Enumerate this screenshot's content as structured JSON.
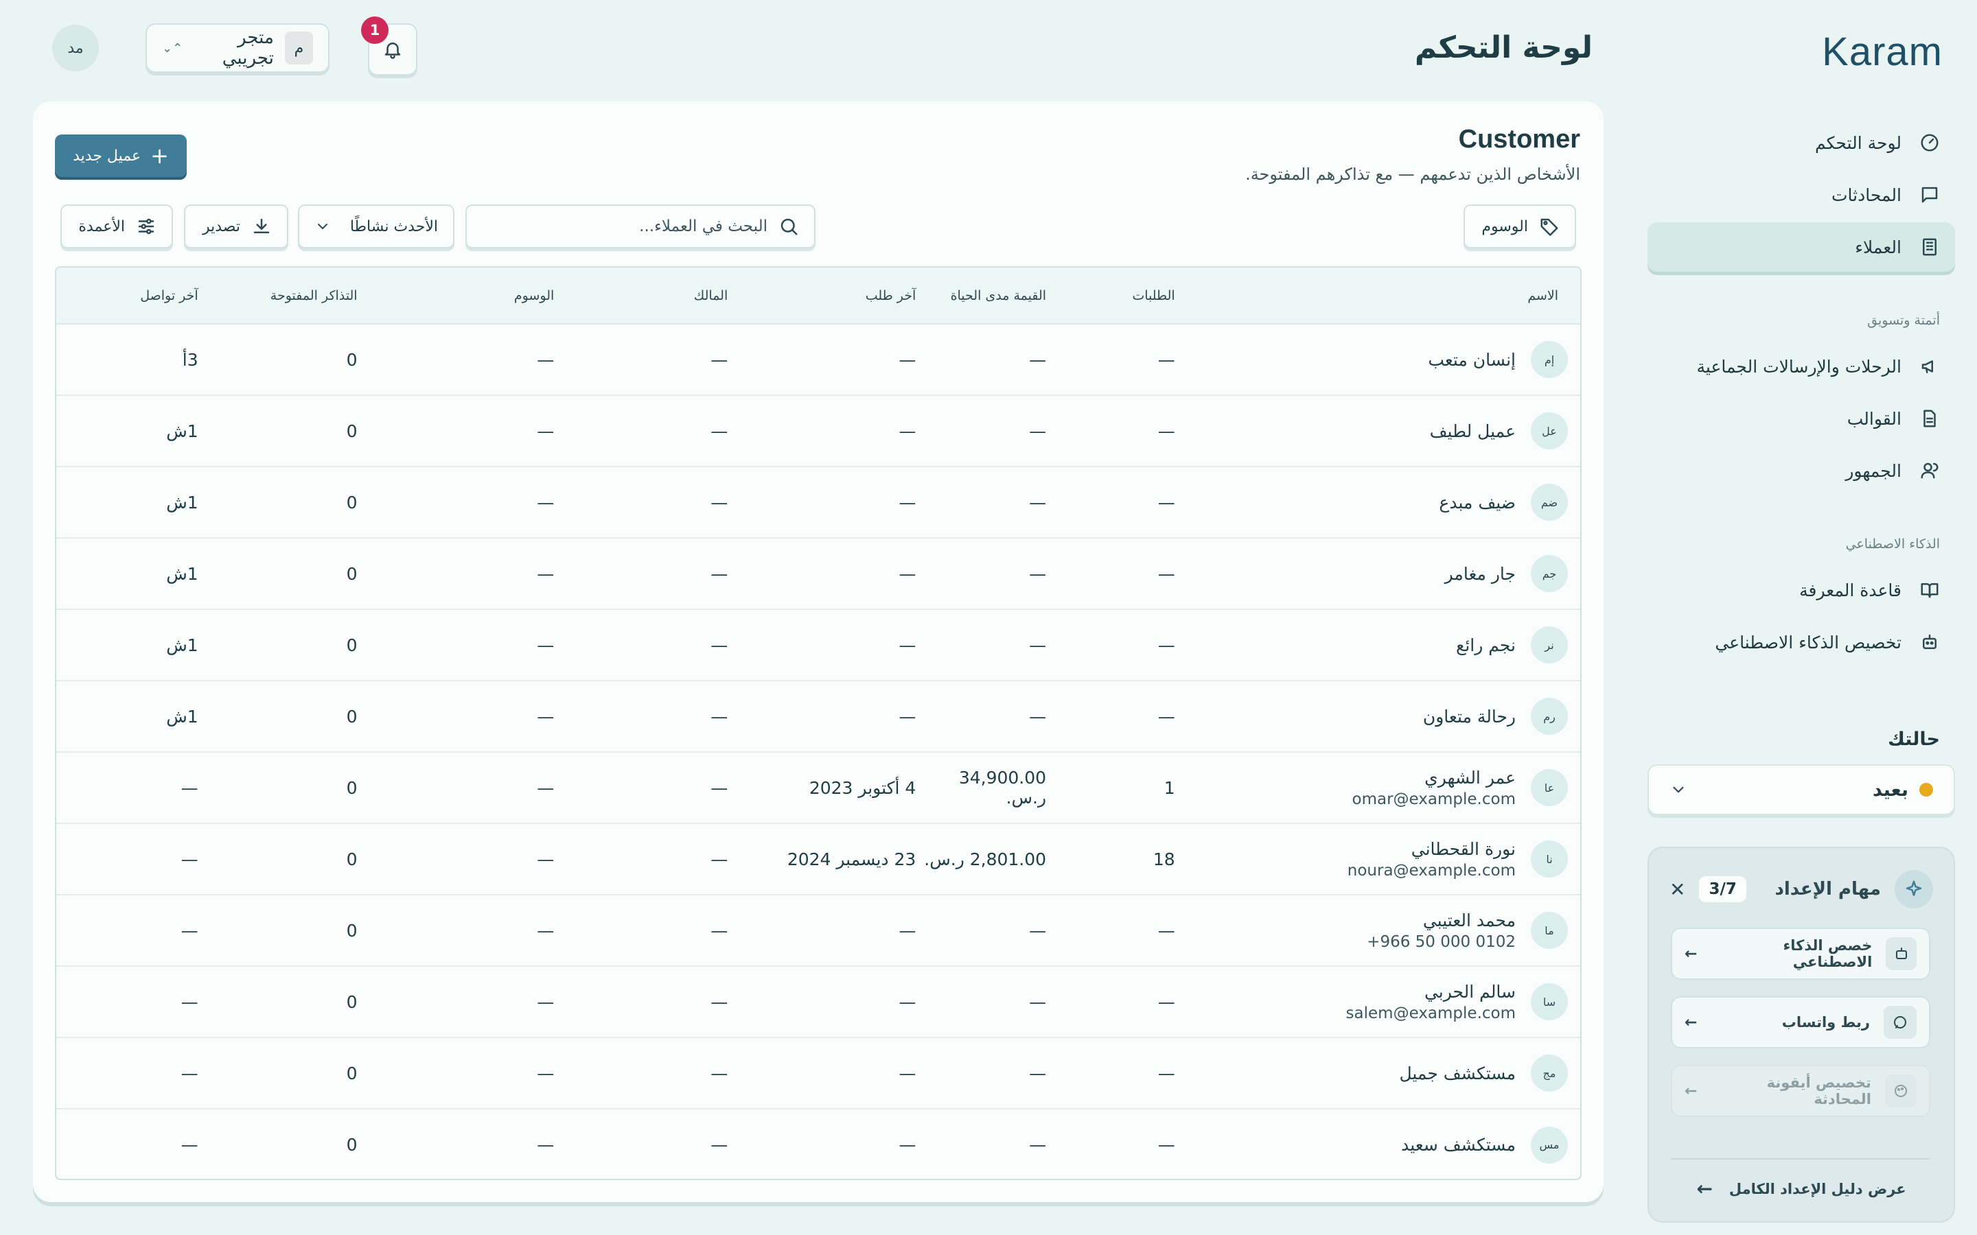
{
  "sidebar": {
    "logo": "Karam",
    "nav": [
      {
        "label": "لوحة التحكم",
        "icon": "gauge-icon",
        "active": false
      },
      {
        "label": "المحادثات",
        "icon": "chat-icon",
        "active": false
      },
      {
        "label": "العملاء",
        "icon": "building-icon",
        "active": true
      }
    ],
    "section_marketing": "أتمتة وتسويق",
    "marketing": [
      {
        "label": "الرحلات والإرسالات الجماعية",
        "icon": "megaphone-icon"
      },
      {
        "label": "القوالب",
        "icon": "document-icon"
      },
      {
        "label": "الجمهور",
        "icon": "users-icon"
      }
    ],
    "section_ai": "الذكاء الاصطناعي",
    "ai": [
      {
        "label": "قاعدة المعرفة",
        "icon": "book-icon"
      },
      {
        "label": "تخصيص الذكاء الاصطناعي",
        "icon": "bot-icon"
      }
    ],
    "status_title": "حالتك",
    "status_value": "بعيد",
    "status_color": "#e8a91c",
    "setup": {
      "title": "مهام الإعداد",
      "count": "3/7",
      "tasks": [
        {
          "label": "خصص الذكاء الاصطناعي",
          "icon": "bot-icon"
        },
        {
          "label": "ربط واتساب",
          "icon": "chat-icon"
        },
        {
          "label": "تخصيص أيقونة المحادثة",
          "icon": "palette-icon"
        }
      ],
      "guide": "عرض دليل الإعداد الكامل"
    }
  },
  "topbar": {
    "title": "لوحة التحكم",
    "notifications": "1",
    "store_name": "متجر تجريبي",
    "store_initial": "م",
    "user_initials": "مد"
  },
  "main": {
    "title": "Customer",
    "subtitle": "الأشخاص الذين تدعمهم — مع تذاكرهم المفتوحة.",
    "new_button": "عميل جديد",
    "tags_button": "الوسوم",
    "search_placeholder": "البحث في العملاء...",
    "sort_label": "الأحدث نشاطًا",
    "export_label": "تصدير",
    "columns_label": "الأعمدة",
    "accent_color": "#3f7d98"
  },
  "table": {
    "headers": [
      "الاسم",
      "الطلبات",
      "القيمة مدى الحياة",
      "آخر طلب",
      "المالك",
      "الوسوم",
      "التذاكر المفتوحة",
      "آخر تواصل"
    ],
    "rows": [
      {
        "initials": "إم",
        "name": "إنسان متعب",
        "sub": "",
        "orders": "—",
        "ltv": "—",
        "last_order": "—",
        "owner": "—",
        "tags": "—",
        "tickets": "0",
        "contact": "3أ"
      },
      {
        "initials": "عل",
        "name": "عميل لطيف",
        "sub": "",
        "orders": "—",
        "ltv": "—",
        "last_order": "—",
        "owner": "—",
        "tags": "—",
        "tickets": "0",
        "contact": "1ش"
      },
      {
        "initials": "ضم",
        "name": "ضيف مبدع",
        "sub": "",
        "orders": "—",
        "ltv": "—",
        "last_order": "—",
        "owner": "—",
        "tags": "—",
        "tickets": "0",
        "contact": "1ش"
      },
      {
        "initials": "جم",
        "name": "جار مغامر",
        "sub": "",
        "orders": "—",
        "ltv": "—",
        "last_order": "—",
        "owner": "—",
        "tags": "—",
        "tickets": "0",
        "contact": "1ش"
      },
      {
        "initials": "نر",
        "name": "نجم رائع",
        "sub": "",
        "orders": "—",
        "ltv": "—",
        "last_order": "—",
        "owner": "—",
        "tags": "—",
        "tickets": "0",
        "contact": "1ش"
      },
      {
        "initials": "رم",
        "name": "رحالة متعاون",
        "sub": "",
        "orders": "—",
        "ltv": "—",
        "last_order": "—",
        "owner": "—",
        "tags": "—",
        "tickets": "0",
        "contact": "1ش"
      },
      {
        "initials": "عا",
        "name": "عمر الشهري",
        "sub": "omar@example.com",
        "orders": "1",
        "ltv": "34,900.00 ر.س.",
        "last_order": "4 أكتوبر 2023",
        "owner": "—",
        "tags": "—",
        "tickets": "0",
        "contact": "—"
      },
      {
        "initials": "نا",
        "name": "نورة القحطاني",
        "sub": "noura@example.com",
        "orders": "18",
        "ltv": "2,801.00 ر.س.",
        "last_order": "23 ديسمبر 2024",
        "owner": "—",
        "tags": "—",
        "tickets": "0",
        "contact": "—"
      },
      {
        "initials": "ما",
        "name": "محمد العتيبي",
        "sub": "+966 50 000 0102",
        "orders": "—",
        "ltv": "—",
        "last_order": "—",
        "owner": "—",
        "tags": "—",
        "tickets": "0",
        "contact": "—"
      },
      {
        "initials": "سا",
        "name": "سالم الحربي",
        "sub": "salem@example.com",
        "orders": "—",
        "ltv": "—",
        "last_order": "—",
        "owner": "—",
        "tags": "—",
        "tickets": "0",
        "contact": "—"
      },
      {
        "initials": "مج",
        "name": "مستكشف جميل",
        "sub": "",
        "orders": "—",
        "ltv": "—",
        "last_order": "—",
        "owner": "—",
        "tags": "—",
        "tickets": "0",
        "contact": "—"
      },
      {
        "initials": "مس",
        "name": "مستكشف سعيد",
        "sub": "",
        "orders": "—",
        "ltv": "—",
        "last_order": "—",
        "owner": "—",
        "tags": "—",
        "tickets": "0",
        "contact": "—"
      }
    ]
  }
}
